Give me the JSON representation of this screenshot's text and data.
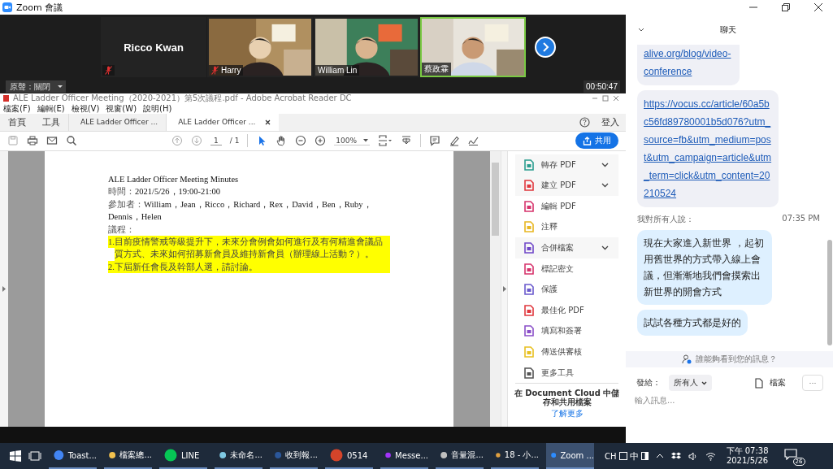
{
  "zoom_window": {
    "title": "Zoom 會議"
  },
  "video_tiles": [
    {
      "kind": "name",
      "name": "Ricco Kwan",
      "muted": true,
      "active": false
    },
    {
      "kind": "video",
      "name": "Harry",
      "muted": true,
      "active": false
    },
    {
      "kind": "video",
      "name": "William Lin",
      "muted": false,
      "active": false
    },
    {
      "kind": "video",
      "name": "蔡政霖",
      "muted": false,
      "active": true
    }
  ],
  "audio_button": {
    "label": "原聲：關閉"
  },
  "timer": "00:50:47",
  "acrobat": {
    "title": "ALE Ladder Officer Meeting（2020-2021）第5次議程.pdf - Adobe Acrobat Reader DC",
    "menu": [
      "檔案(F)",
      "編輯(E)",
      "檢視(V)",
      "視窗(W)",
      "說明(H)"
    ],
    "nav": [
      "首頁",
      "工具"
    ],
    "tabs": [
      {
        "label": "ALE Ladder Officer ...",
        "selected": false
      },
      {
        "label": "ALE Ladder Officer ...",
        "selected": true
      }
    ],
    "sign_in": "登入",
    "page_number": "1",
    "page_total": "/ 1",
    "zoom_level": "100%",
    "share_button": "共用"
  },
  "document": {
    "title": "ALE Ladder Officer Meeting Minutes",
    "lines": [
      {
        "label": "時間：",
        "text": "2021/5/26，19:00-21:00"
      },
      {
        "label": "參加者：",
        "text": "William，Jean，Ricco，Richard，Rex，David，Ben，Ruby，Dennis，Helen"
      }
    ],
    "agenda_label": "議程：",
    "agenda": [
      {
        "number": "1.",
        "text": "目前疫情警戒等級提升下，未來分會例會如何進行及有何精進會議品質方式、未來如何招募新會員及維持新會員（辦理線上活動？）。",
        "highlighted": true
      },
      {
        "number": "2.",
        "text": "下屆新任會長及幹部人選，請討論。",
        "highlighted": true
      }
    ]
  },
  "tools": [
    {
      "label": "轉存 PDF",
      "color": "#2a9d8f",
      "expandable": true
    },
    {
      "label": "建立 PDF",
      "color": "#e0383e",
      "expandable": true
    },
    {
      "label": "編輯 PDF",
      "color": "#d6336c",
      "expandable": false
    },
    {
      "label": "注釋",
      "color": "#e8b620",
      "expandable": false
    },
    {
      "label": "合併檔案",
      "color": "#7048c8",
      "expandable": true
    },
    {
      "label": "標記密文",
      "color": "#d6336c",
      "expandable": false
    },
    {
      "label": "保護",
      "color": "#6a5acd",
      "expandable": false
    },
    {
      "label": "最佳化 PDF",
      "color": "#e0383e",
      "expandable": false
    },
    {
      "label": "填寫和簽署",
      "color": "#8a4fc8",
      "expandable": false
    },
    {
      "label": "傳送供審核",
      "color": "#e8c020",
      "expandable": false
    },
    {
      "label": "更多工具",
      "color": "#555555",
      "expandable": false
    }
  ],
  "tools_footer": {
    "text": "在 Document Cloud 中儲存和共用檔案",
    "link": "了解更多"
  },
  "chat": {
    "title": "聊天",
    "messages": [
      {
        "kind": "link",
        "text": "alive.org/blog/video-conference"
      },
      {
        "kind": "link",
        "text": "https://vocus.cc/article/60a5bc56fd89780001b5d076?utm_source=fb&utm_medium=post&utm_campaign=article&utm_term=click&utm_content=20210524"
      },
      {
        "kind": "header",
        "text": "我對所有人說：",
        "time": "07:35 PM"
      },
      {
        "kind": "mine",
        "text": "現在大家進入新世界 ，起初用舊世界的方式帶入線上會議，但漸漸地我們會摸索出新世界的開會方式"
      },
      {
        "kind": "mine",
        "text": "試試各種方式都是好的"
      }
    ],
    "privacy_notice": "誰能夠看到您的訊息？",
    "send_to_label": "發給：",
    "recipient": "所有人",
    "file_button": "檔案",
    "more_button": "···",
    "placeholder": "輸入訊息..."
  },
  "taskbar": {
    "apps": [
      {
        "label": "Toast...",
        "color": "#4285f4",
        "selected": false
      },
      {
        "label": "檔案總...",
        "color": "#f2c14e",
        "selected": false
      },
      {
        "label": "LINE",
        "color": "#06c755",
        "selected": false
      },
      {
        "label": "未命名...",
        "color": "#7ec8e3",
        "selected": false
      },
      {
        "label": "收到報...",
        "color": "#2b579a",
        "selected": false
      },
      {
        "label": "0514",
        "color": "#d4442a",
        "selected": false
      },
      {
        "label": "Messe...",
        "color": "#a334fa",
        "selected": false
      },
      {
        "label": "音量混...",
        "color": "#c0c0c0",
        "selected": false
      },
      {
        "label": "18 - 小...",
        "color": "#e0a040",
        "selected": false
      },
      {
        "label": "Zoom ...",
        "color": "#2d8cff",
        "selected": true
      }
    ],
    "ime": [
      "CH",
      "中"
    ],
    "time": "下午 07:38",
    "date": "2021/5/26",
    "notifications": "26"
  }
}
